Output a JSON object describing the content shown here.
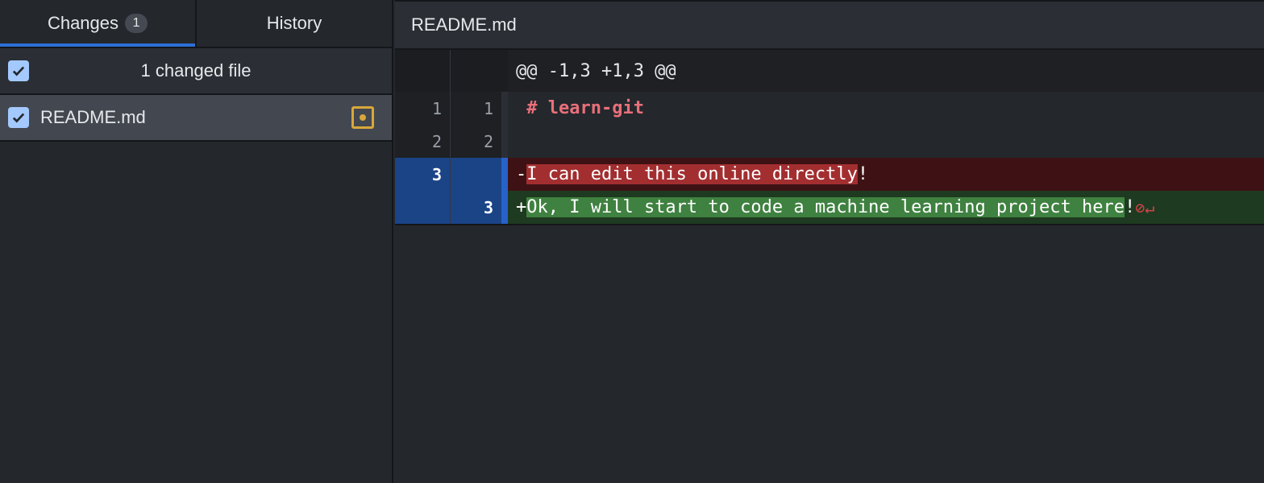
{
  "tabs": [
    {
      "label": "Changes",
      "badge": "1",
      "active": true
    },
    {
      "label": "History",
      "active": false
    }
  ],
  "changes": {
    "summary": "1 changed file",
    "all_checked": true,
    "files": [
      {
        "name": "README.md",
        "checked": true,
        "status": "modified",
        "status_color": "#d8a73a"
      }
    ]
  },
  "diff": {
    "filename": "README.md",
    "hunk": "@@ -1,3 +1,3 @@",
    "lines": [
      {
        "type": "context",
        "old": "1",
        "new": "1",
        "text": " # learn-git"
      },
      {
        "type": "context",
        "old": "2",
        "new": "2",
        "text": ""
      },
      {
        "type": "deleted",
        "old": "3",
        "new": "",
        "prefix": "-",
        "hl": "I can edit this online directly",
        "rest": "!"
      },
      {
        "type": "added",
        "old": "",
        "new": "3",
        "prefix": "+",
        "hl": "Ok, I will start to code a machine learning project here",
        "rest": "!",
        "eof_icons": "⊘↵"
      }
    ]
  },
  "colors": {
    "accent": "#2b6fd6",
    "deleted": "#a22e30",
    "added": "#3f8140",
    "selected_gutter": "#1b4487"
  }
}
